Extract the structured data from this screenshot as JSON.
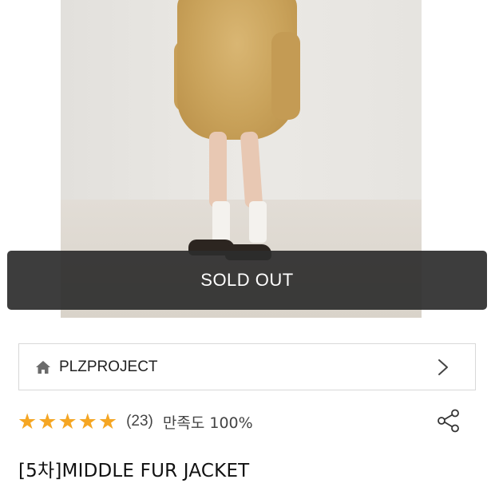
{
  "product": {
    "sold_out_label": "SOLD OUT",
    "title": "[5차]MIDDLE FUR JACKET"
  },
  "brand": {
    "name": "PLZPROJECT",
    "icon": "home-icon",
    "nav_icon": "chevron-right-icon"
  },
  "rating": {
    "stars": 5,
    "star_glyph": "★",
    "review_count": "(23)",
    "satisfaction": "만족도 100%"
  },
  "icons": {
    "share": "share-icon"
  },
  "colors": {
    "star": "#f5a623",
    "sold_out_bg": "#2c2c2c"
  }
}
